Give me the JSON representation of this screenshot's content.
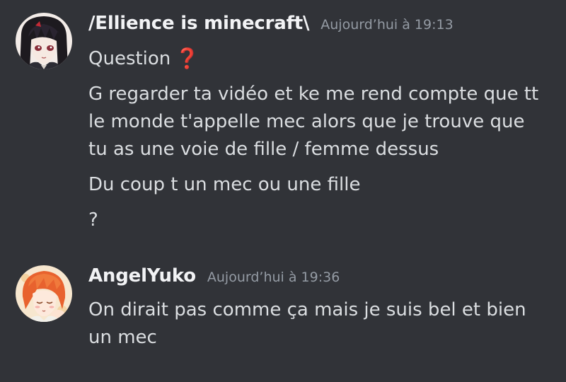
{
  "messages": [
    {
      "avatar": "avatar-dark-hair-character",
      "username": "/Ellience is minecraft\\",
      "timestamp": "Aujourd’hui à 19:13",
      "lines": {
        "l1": "Question",
        "l1_emoji": "❓",
        "l2": "G regarder ta vidéo et ke me rend compte que tt",
        "l3": "le monde t'appelle mec alors que je trouve que",
        "l4": "tu as une voie de fille / femme dessus",
        "l5": "Du coup t un mec ou une fille",
        "l6": "?"
      }
    },
    {
      "avatar": "avatar-orange-hair-character",
      "username": "AngelYuko",
      "timestamp": "Aujourd’hui à 19:36",
      "lines": {
        "l1": "On dirait pas comme ça mais je suis bel et bien",
        "l2": "un mec"
      }
    }
  ],
  "colors": {
    "background": "#313338",
    "username": "#f2f3f5",
    "text": "#dbdee1",
    "timestamp": "#949ba4",
    "emoji_red": "#dd2e44"
  }
}
